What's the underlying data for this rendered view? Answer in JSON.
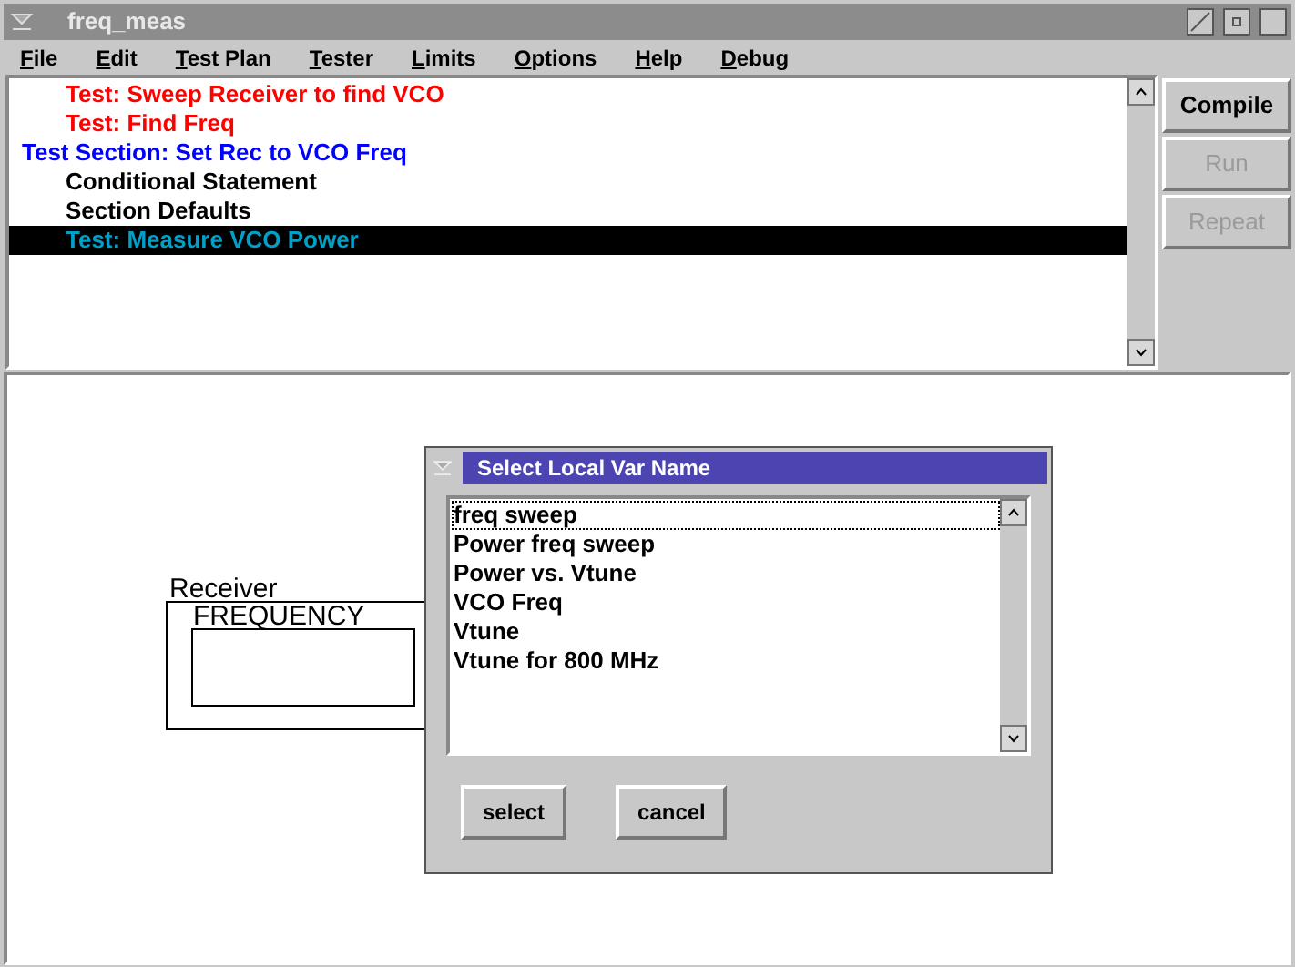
{
  "window": {
    "title": "freq_meas"
  },
  "menu": [
    "File",
    "Edit",
    "Test Plan",
    "Tester",
    "Limits",
    "Options",
    "Help",
    "Debug"
  ],
  "plan_items": [
    {
      "kind": "test",
      "label": "Test: Sweep Receiver to find VCO",
      "selected": false
    },
    {
      "kind": "test",
      "label": "Test: Find Freq",
      "selected": false
    },
    {
      "kind": "section",
      "label": "Test Section: Set Rec to VCO Freq",
      "selected": false
    },
    {
      "kind": "statement",
      "label": "Conditional Statement",
      "selected": false
    },
    {
      "kind": "statement",
      "label": "Section Defaults",
      "selected": false
    },
    {
      "kind": "test",
      "label": "Test: Measure VCO Power",
      "selected": true
    }
  ],
  "buttons": [
    {
      "label": "Compile",
      "disabled": false
    },
    {
      "label": "Run",
      "disabled": true
    },
    {
      "label": "Repeat",
      "disabled": true
    }
  ],
  "canvas": {
    "block_title": "Receiver",
    "field_label": "FREQUENCY"
  },
  "dialog": {
    "title": "Select Local Var Name",
    "items": [
      {
        "label": "freq sweep",
        "focused": true
      },
      {
        "label": "Power freq sweep",
        "focused": false
      },
      {
        "label": "Power vs. Vtune",
        "focused": false
      },
      {
        "label": "VCO Freq",
        "focused": false
      },
      {
        "label": "Vtune",
        "focused": false
      },
      {
        "label": "Vtune for 800 MHz",
        "focused": false
      }
    ],
    "buttons": [
      "select",
      "cancel"
    ]
  }
}
